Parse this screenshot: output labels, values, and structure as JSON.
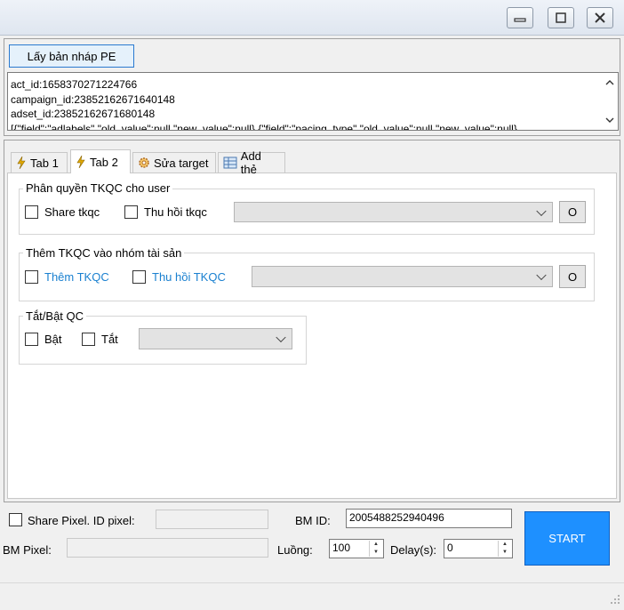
{
  "window": {
    "minimize_icon": "minimize-icon",
    "maximize_icon": "maximize-icon",
    "close_icon": "close-icon"
  },
  "top": {
    "get_draft_button": "Lấy bản nháp PE",
    "log_lines": [
      "act_id:1658370271224766",
      "campaign_id:23852162671640148",
      "adset_id:23852162671680148",
      "[{\"field\":\"adlabels\",\"old_value\":null,\"new_value\":null},{\"field\":\"pacing_type\",\"old_value\":null,\"new_value\":null}"
    ]
  },
  "tabs": [
    {
      "label": "Tab 1",
      "icon": "lightning-icon"
    },
    {
      "label": "Tab 2",
      "icon": "lightning-icon"
    },
    {
      "label": "Sửa target",
      "icon": "gear-icon"
    },
    {
      "label": "Add thẻ",
      "icon": "table-icon"
    }
  ],
  "group_share": {
    "legend": "Phân quyền TKQC cho user",
    "share_label": "Share tkqc",
    "revoke_label": "Thu hồi tkqc",
    "select_value": "",
    "ok_button": "O"
  },
  "group_asset": {
    "legend": "Thêm TKQC vào nhóm tài sản",
    "add_label": "Thêm TKQC",
    "revoke_label": "Thu hồi TKQC",
    "select_value": "",
    "ok_button": "O"
  },
  "group_toggle": {
    "legend": "Tắt/Bật QC",
    "on_label": "Bật",
    "off_label": "Tắt",
    "select_value": ""
  },
  "bottom": {
    "share_pixel_label": "Share Pixel. ID pixel:",
    "pixel_id_value": "",
    "bm_id_label": "BM ID:",
    "bm_id_value": "2005488252940496",
    "bm_pixel_label": "BM Pixel:",
    "bm_pixel_value": "",
    "threads_label": "Luồng:",
    "threads_value": "100",
    "delay_label": "Delay(s):",
    "delay_value": "0",
    "start_button": "START"
  },
  "colors": {
    "start_bg": "#1e90ff",
    "link_text": "#1a80d0"
  }
}
